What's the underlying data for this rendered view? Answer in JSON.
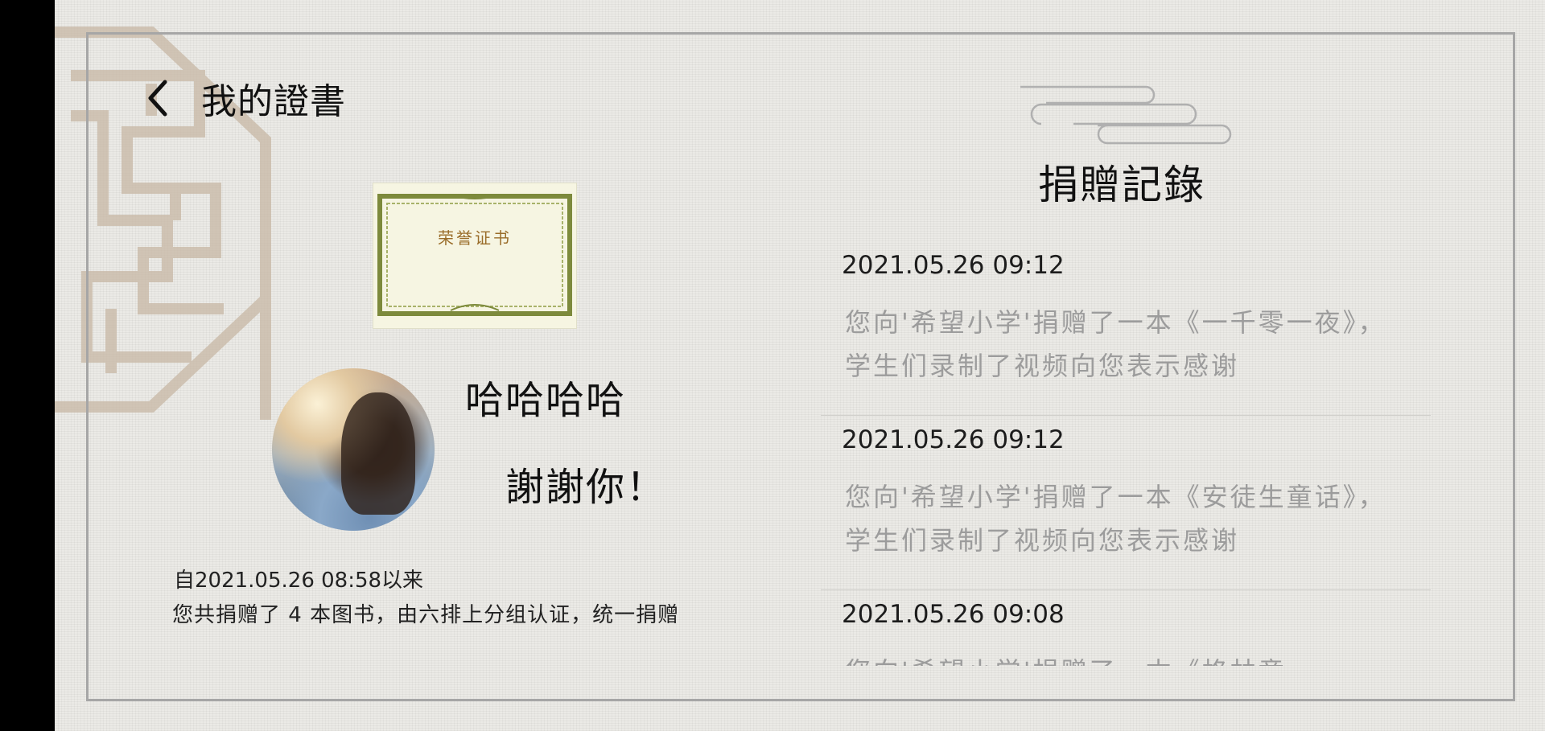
{
  "header": {
    "title": "我的證書",
    "back_icon": "chevron-left-icon"
  },
  "certificate": {
    "title": "荣誉证书"
  },
  "profile": {
    "nickname": "哈哈哈哈",
    "thanks": "謝謝你！"
  },
  "summary": {
    "since": "自2021.05.26 08:58以来",
    "text": "您共捐赠了 4 本图书，由六排上分组认证，统一捐赠"
  },
  "records_section": {
    "title": "捐贈記錄",
    "items": [
      {
        "time": "2021.05.26 09:12",
        "desc": "您向'希望小学'捐赠了一本《一千零一夜》，学生们录制了视频向您表示感谢"
      },
      {
        "time": "2021.05.26 09:12",
        "desc": "您向'希望小学'捐赠了一本《安徒生童话》，学生们录制了视频向您表示感谢"
      },
      {
        "time": "2021.05.26 09:08",
        "desc": "您向'希望小学'捐赠了一本《格林童"
      }
    ]
  },
  "colors": {
    "frame": "#a6a6a6",
    "lattice": "#c8b8a5",
    "cert_border": "#7d8a3c",
    "cert_text": "#9a6d2a"
  }
}
